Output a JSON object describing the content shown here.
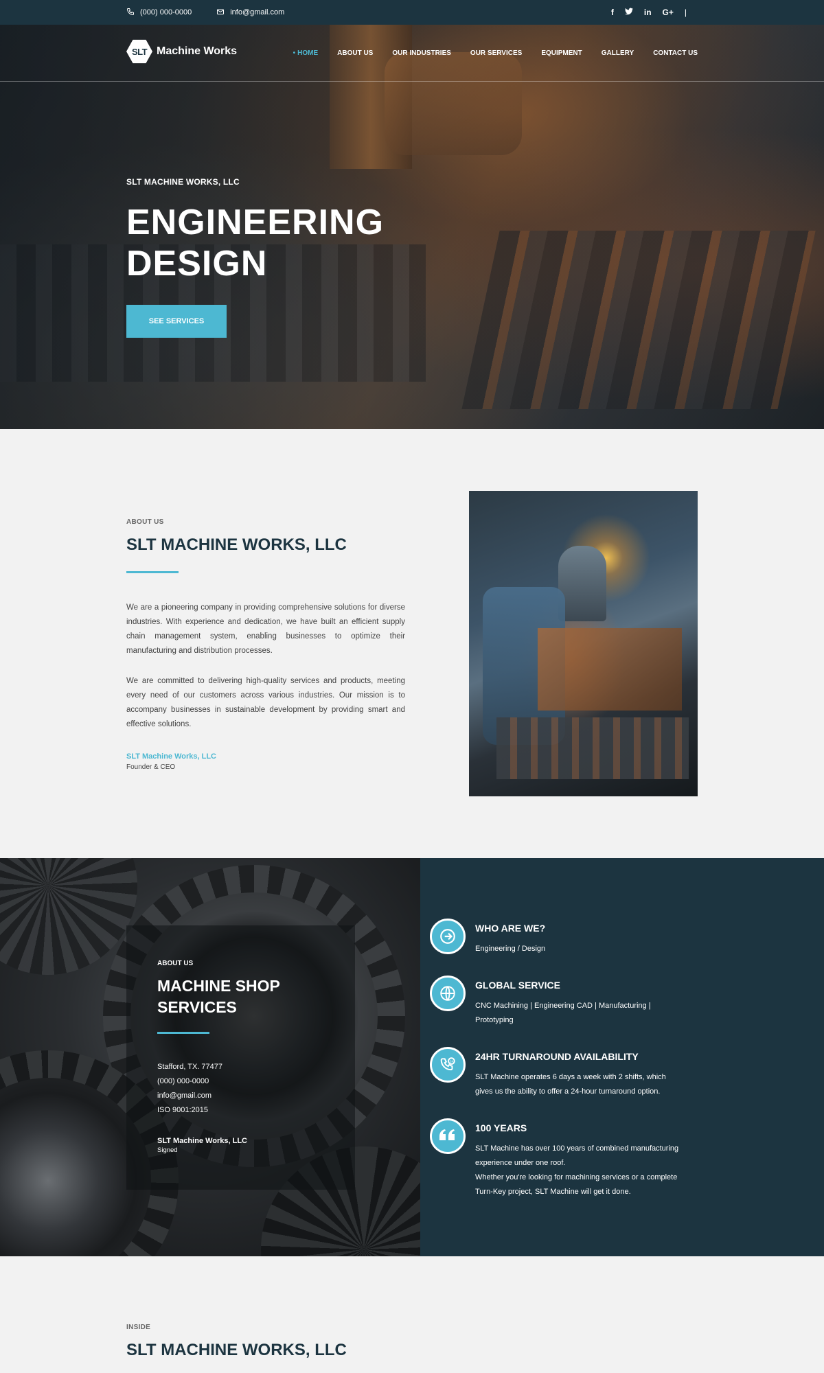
{
  "topbar": {
    "phone": "(000) 000-0000",
    "email": "info@gmail.com",
    "social": [
      "f",
      "t",
      "in",
      "G+"
    ],
    "separator": "|"
  },
  "nav": {
    "logo_mark": "SLT",
    "logo_name": "Machine Works",
    "items": [
      "HOME",
      "ABOUT US",
      "OUR INDUSTRIES",
      "OUR SERVICES",
      "EQUIPMENT",
      "GALLERY",
      "CONTACT US"
    ]
  },
  "hero": {
    "eyebrow": "SLT MACHINE WORKS, LLC",
    "title_line1": "ENGINEERING",
    "title_line2": "DESIGN",
    "button": "SEE SERVICES"
  },
  "about": {
    "eyebrow": "ABOUT US",
    "title": "SLT MACHINE WORKS, LLC",
    "para1": "We are a pioneering company in providing comprehensive solutions for diverse industries. With experience and dedication, we have built an efficient supply chain management system, enabling businesses to optimize their manufacturing and distribution processes.",
    "para2": "We are committed to delivering high-quality services and products, meeting every need of our customers across various industries. Our mission is to accompany businesses in sustainable development by providing smart and effective solutions.",
    "signature_name": "SLT Machine Works, LLC",
    "signature_role": "Founder & CEO"
  },
  "services": {
    "card": {
      "eyebrow": "ABOUT US",
      "title_line1": "MACHINE SHOP",
      "title_line2": "SERVICES",
      "address": "Stafford, TX. 77477",
      "phone": "(000) 000-0000",
      "email": "info@gmail.com",
      "iso": "ISO 9001:2015",
      "signer": "SLT Machine Works, LLC",
      "signed": "Signed"
    },
    "features": [
      {
        "title": "WHO ARE WE?",
        "desc": "Engineering / Design",
        "icon": "arrow-right-circle-icon"
      },
      {
        "title": "GLOBAL SERVICE",
        "desc": "CNC Machining | Engineering CAD | Manufacturing | Prototyping",
        "icon": "globe-icon"
      },
      {
        "title": "24HR TURNAROUND AVAILABILITY",
        "desc": "SLT Machine operates 6 days a week with 2 shifts, which gives us the ability to offer a 24-hour turnaround option.",
        "icon": "phone-24-icon"
      },
      {
        "title": "100 YEARS",
        "desc1": "SLT Machine has over 100 years of combined manufacturing experience under one roof.",
        "desc2": "Whether you're looking for machining services or a complete Turn-Key project, SLT Machine will get it done.",
        "icon": "quote-icon"
      }
    ]
  },
  "inside": {
    "eyebrow": "INSIDE",
    "title": "SLT MACHINE WORKS, LLC"
  },
  "colors": {
    "navy": "#1c3440",
    "accent": "#4db8d2"
  }
}
